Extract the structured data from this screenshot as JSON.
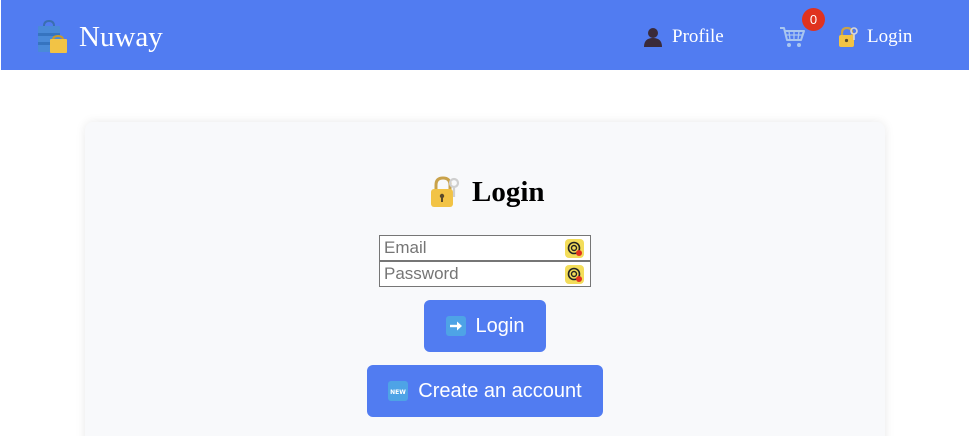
{
  "navbar": {
    "brand_name": "Nuway",
    "profile_label": "Profile",
    "cart_count": "0",
    "login_label": "Login",
    "background_color": "#517cf1",
    "badge_color": "#e0321f"
  },
  "login_card": {
    "title": "Login",
    "email_placeholder": "Email",
    "password_placeholder": "Password",
    "login_button_label": "Login",
    "create_account_button_label": "Create an account",
    "new_badge_text": "NEW"
  },
  "icons": {
    "brand": "shopping-bags-icon",
    "profile": "bust-in-silhouette-icon",
    "cart": "shopping-cart-icon",
    "login": "lock-with-key-icon",
    "title": "lock-with-key-icon",
    "field": "password-manager-icon",
    "login_button": "right-arrow-icon",
    "create_button": "new-badge-icon"
  }
}
